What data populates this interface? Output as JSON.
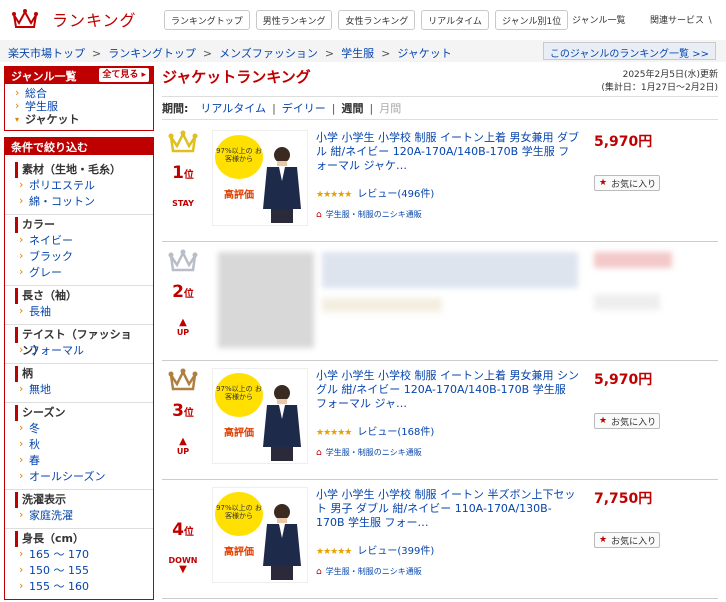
{
  "header": {
    "logo_title": "ランキング",
    "tabs": [
      "ランキングトップ",
      "男性ランキング",
      "女性ランキング",
      "リアルタイム",
      "ジャンル別1位"
    ],
    "genre_list": "ジャンル一覧",
    "related": "関連サービス ∖"
  },
  "breadcrumb": [
    "楽天市場トップ",
    "ランキングトップ",
    "メンズファッション",
    "学生服",
    "ジャケット"
  ],
  "genre_ranking_link": "このジャンルのランキング一覧 >>",
  "sidebar": {
    "genre_title": "ジャンル一覧",
    "show_all": "全て見る",
    "genres": [
      {
        "label": "総合",
        "current": false
      },
      {
        "label": "学生服",
        "current": false
      },
      {
        "label": "ジャケット",
        "current": true
      }
    ],
    "filter_title": "条件で絞り込む",
    "filters": [
      {
        "title": "素材（生地・毛糸）",
        "items": [
          "ポリエステル",
          "綿・コットン"
        ]
      },
      {
        "title": "カラー",
        "items": [
          "ネイビー",
          "ブラック",
          "グレー"
        ]
      },
      {
        "title": "長さ（袖）",
        "items": [
          "長袖"
        ]
      },
      {
        "title": "テイスト（ファッション）",
        "items": [
          "フォーマル"
        ]
      },
      {
        "title": "柄",
        "items": [
          "無地"
        ]
      },
      {
        "title": "シーズン",
        "items": [
          "冬",
          "秋",
          "春",
          "オールシーズン"
        ]
      },
      {
        "title": "洗濯表示",
        "items": [
          "家庭洗濯"
        ]
      },
      {
        "title": "身長（cm）",
        "items": [
          "165 ～ 170",
          "150 ～ 155",
          "155 ～ 160"
        ]
      }
    ]
  },
  "main": {
    "title": "ジャケットランキング",
    "updated": "2025年2月5日(水)更新",
    "period_range": "(集計日：1月27日〜2月2日)",
    "period_label": "期間:",
    "period_options": [
      {
        "label": "リアルタイム",
        "state": "link"
      },
      {
        "label": "デイリー",
        "state": "link"
      },
      {
        "label": "週間",
        "state": "active"
      },
      {
        "label": "月間",
        "state": "disabled"
      }
    ],
    "fav_label": "お気に入り",
    "rank_unit": "位",
    "items": [
      {
        "rank": "1",
        "move": "STAY",
        "move_arrow": "",
        "crown_color": "#e0c020",
        "name": "小学 小学生 小学校 制服 イートン上着 男女兼用 ダブル 紺/ネイビー 120A-170A/140B-170B 学生服 フォーマル ジャケ…",
        "price": "5,970円",
        "stars": "★★★★★",
        "reviews": "レビュー(496件)",
        "shop": "学生服・制服のニシキ通販",
        "badge_text": "97%以上の お客様から",
        "badge_hi": "高評価",
        "blurred": false
      },
      {
        "rank": "2",
        "move": "UP",
        "move_arrow": "▲",
        "crown_color": "#b8bec8",
        "name": "",
        "price": "",
        "stars": "",
        "reviews": "",
        "shop": "",
        "badge_text": "",
        "badge_hi": "",
        "blurred": true
      },
      {
        "rank": "3",
        "move": "UP",
        "move_arrow": "▲",
        "crown_color": "#b08040",
        "name": "小学 小学生 小学校 制服 イートン上着 男女兼用 シングル 紺/ネイビー 120A-170A/140B-170B 学生服 フォーマル ジャ…",
        "price": "5,970円",
        "stars": "★★★★★",
        "reviews": "レビュー(168件)",
        "shop": "学生服・制服のニシキ通販",
        "badge_text": "97%以上の お客様から",
        "badge_hi": "高評価",
        "blurred": false
      },
      {
        "rank": "4",
        "move": "DOWN",
        "move_arrow": "▼",
        "crown_color": "",
        "name": "小学 小学生 小学校 制服 イートン 半ズボン上下セット 男子 ダブル 紺/ネイビー 110A-170A/130B-170B 学生服 フォー…",
        "price": "7,750円",
        "stars": "★★★★★",
        "reviews": "レビュー(399件)",
        "shop": "学生服・制服のニシキ通販",
        "badge_text": "97%以上の お客様から",
        "badge_hi": "高評価",
        "blurred": false
      }
    ]
  }
}
